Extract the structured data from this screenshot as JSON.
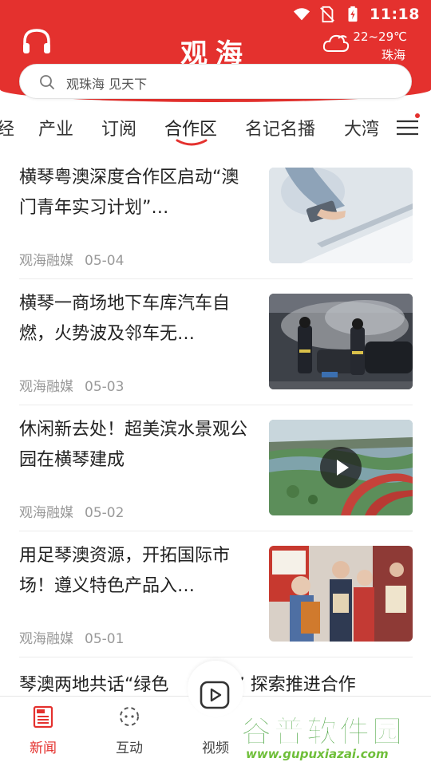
{
  "status_bar": {
    "time": "11:18",
    "icons": [
      "wifi-icon",
      "no-sim-icon",
      "battery-charging-icon"
    ]
  },
  "header": {
    "title": "观海",
    "weather": {
      "temperature": "22~29℃",
      "city": "珠海",
      "icon": "cloud-icon"
    },
    "left_icon": "headphones-icon"
  },
  "search": {
    "placeholder": "观珠海 见天下"
  },
  "tabs": [
    {
      "label": "经"
    },
    {
      "label": "产业"
    },
    {
      "label": "订阅"
    },
    {
      "label": "合作区",
      "active": true
    },
    {
      "label": "名记名播"
    },
    {
      "label": "大湾"
    }
  ],
  "colors": {
    "brand_red": "#e4312e",
    "meta_gray": "#999999",
    "watermark_green": "#3a9d2f"
  },
  "news": [
    {
      "title": "横琴粤澳深度合作区启动“澳门青年实习计划”…",
      "source": "观海融媒",
      "date": "05-04",
      "image": "hand-phone-laptop-photo"
    },
    {
      "title": "横琴一商场地下车库汽车自燃，火势波及邻车无…",
      "source": "观海融媒",
      "date": "05-03",
      "image": "firefighters-car-fire-photo"
    },
    {
      "title": "休闲新去处！超美滨水景观公园在横琴建成",
      "source": "观海融媒",
      "date": "05-02",
      "image": "waterfront-park-video",
      "is_video": true
    },
    {
      "title": "用足琴澳资源，开拓国际市场！遵义特色产品入…",
      "source": "观海融媒",
      "date": "05-01",
      "image": "product-promotion-photo"
    }
  ],
  "partial_news": {
    "title_left": "琴澳两地共话“绿色",
    "title_right": "市” 探索推进合作"
  },
  "bottom_nav": [
    {
      "label": "新闻",
      "icon": "newspaper-icon",
      "active": true
    },
    {
      "label": "互动",
      "icon": "interaction-icon"
    },
    {
      "label": "视频",
      "icon": "video-play-icon"
    },
    {
      "label": "",
      "icon": ""
    },
    {
      "label": "",
      "icon": ""
    }
  ],
  "watermark": {
    "text": "谷普软件园",
    "url": "www.gupuxiazai.com"
  }
}
